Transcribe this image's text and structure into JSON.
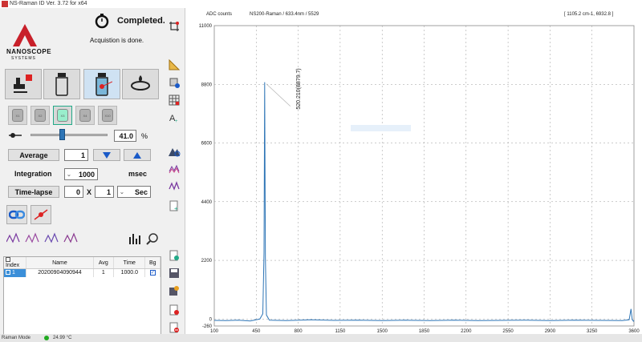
{
  "window": {
    "title": "NS-Raman ID Ver. 3.72 for x64"
  },
  "status_panel": {
    "state": "Completed.",
    "message": "Acquistion is done."
  },
  "logo": {
    "name": "NANOSCOPE",
    "sub": "SYSTEMS"
  },
  "big_buttons": [
    {
      "icon": "laser-device-icon"
    },
    {
      "icon": "empty-vial-icon"
    },
    {
      "icon": "sample-vial-laser-icon"
    },
    {
      "icon": "rotate-stage-icon"
    }
  ],
  "filters": [
    "X1",
    "X2",
    "X3",
    "X4",
    "X10"
  ],
  "power": {
    "value": "41.0",
    "unit": "%",
    "level": 0.41
  },
  "average": {
    "label": "Average",
    "value": "1"
  },
  "integration": {
    "label": "Integration",
    "value": "1000",
    "unit": "msec"
  },
  "timelapse": {
    "label": "Time-lapse",
    "count": "0",
    "separator": "X",
    "interval": "1",
    "unit": "Sec"
  },
  "table": {
    "headers": [
      "Index",
      "Name",
      "Avg",
      "Time",
      "Bg"
    ],
    "rows": [
      {
        "index": "1",
        "name": "20200904090944",
        "avg": "1",
        "time": "1000.0",
        "bg": true
      }
    ]
  },
  "statusbar": {
    "mode": "Raman Mode",
    "temp": "24.99 °C"
  },
  "plot": {
    "y_label": "ADC counts",
    "info": "NS200-Raman / 633.4nm / 5529",
    "cursor": "[ 1105.2 cm-1,   6932.8 ]"
  },
  "chart_data": {
    "type": "line",
    "ylabel": "ADC counts",
    "xlim": [
      100,
      3600
    ],
    "ylim": [
      -260,
      11000
    ],
    "x_ticks": [
      "100",
      "450",
      "800",
      "1150",
      "1500",
      "1850",
      "2200",
      "2550",
      "2900",
      "3250",
      "3600"
    ],
    "y_ticks": [
      "-260",
      "0",
      "2200",
      "4400",
      "6600",
      "8800",
      "11000"
    ],
    "annotation": "520.210(8879.7)",
    "peak": {
      "x": 520.21,
      "y": 8879.7
    },
    "series": [
      {
        "color": "#2e75b6",
        "x": [
          100,
          200,
          300,
          400,
          480,
          505,
          515,
          520.21,
          526,
          535,
          560,
          700,
          900,
          1100,
          1300,
          1500,
          1700,
          1900,
          2100,
          2300,
          2500,
          2700,
          2900,
          3100,
          3300,
          3500,
          3560,
          3575,
          3585,
          3595,
          3600
        ],
        "y": [
          -50,
          -60,
          -40,
          -70,
          0,
          200,
          2500,
          8879.7,
          2300,
          150,
          -40,
          -60,
          -30,
          -50,
          -40,
          -60,
          -45,
          -55,
          -40,
          -60,
          -50,
          -45,
          -55,
          -40,
          -50,
          -60,
          -30,
          380,
          -20,
          -80,
          -50
        ]
      }
    ]
  }
}
